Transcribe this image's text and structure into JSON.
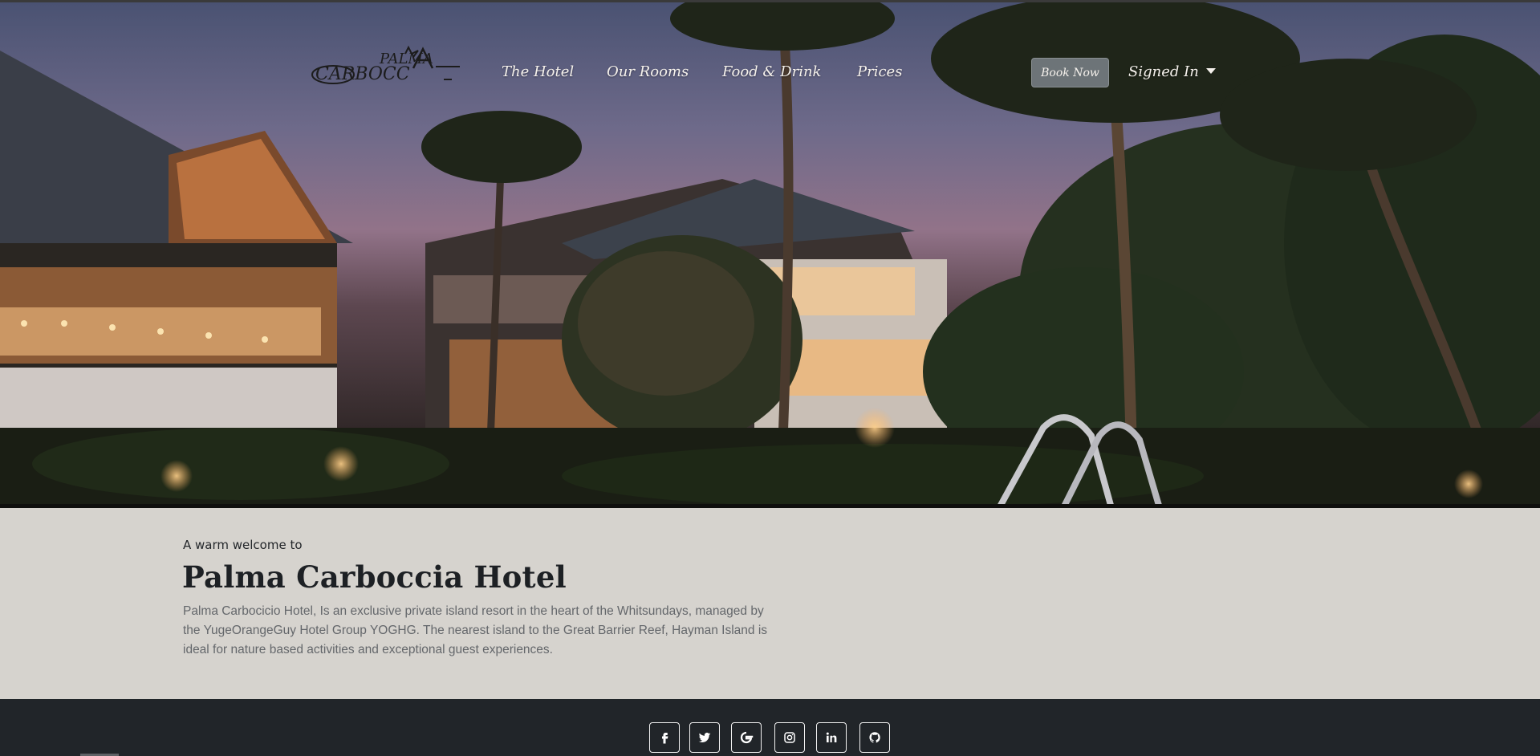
{
  "nav": {
    "logo_text": "CARBOCCIA PALMA",
    "links": [
      "The Hotel",
      "Our Rooms",
      "Food & Drink",
      "Prices"
    ],
    "book_label": "Book Now",
    "account_label": "Signed In"
  },
  "welcome": {
    "kicker": "A warm welcome to",
    "title": "Palma Carboccia Hotel",
    "text": "Palma Carbocicio Hotel, Is an exclusive private island resort in the heart of the Whitsundays, managed by the YugeOrangeGuy Hotel Group YOGHG. The nearest island to the Great Barrier Reef, Hayman Island is ideal for nature based activities and exceptional guest experiences."
  },
  "footer": {
    "social": [
      "facebook-icon",
      "twitter-icon",
      "google-icon",
      "instagram-icon",
      "linkedin-icon",
      "github-icon"
    ]
  },
  "colors": {
    "footer_bg": "#212529",
    "welcome_bg": "#d6d3ce",
    "button_bg": "#6d7478"
  }
}
